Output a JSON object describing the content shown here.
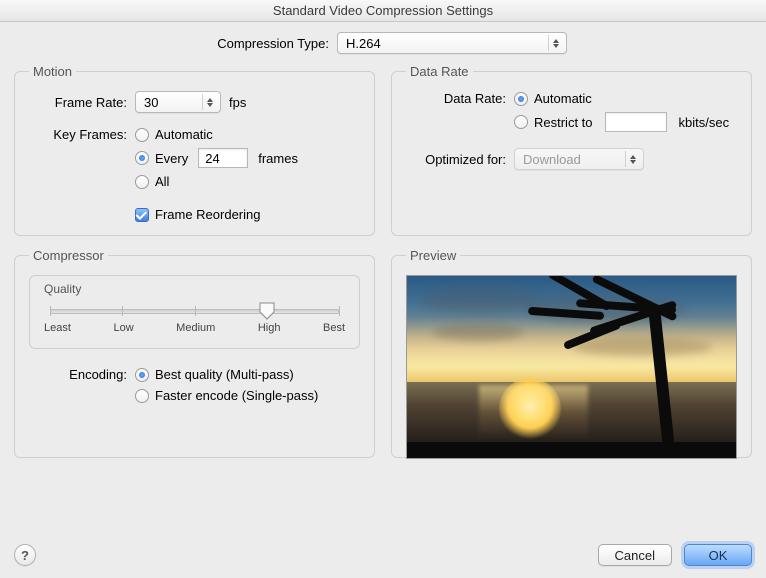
{
  "window_title": "Standard Video Compression Settings",
  "compression_type_label": "Compression Type:",
  "compression_type_value": "H.264",
  "motion": {
    "legend": "Motion",
    "frame_rate_label": "Frame Rate:",
    "frame_rate_value": "30",
    "frame_rate_unit": "fps",
    "key_frames_label": "Key Frames:",
    "kf_automatic": "Automatic",
    "kf_every": "Every",
    "kf_every_value": "24",
    "kf_every_unit": "frames",
    "kf_all": "All",
    "frame_reordering": "Frame Reordering"
  },
  "data_rate": {
    "legend": "Data Rate",
    "label": "Data Rate:",
    "automatic": "Automatic",
    "restrict_to": "Restrict to",
    "restrict_value": "",
    "restrict_unit": "kbits/sec",
    "optimized_for_label": "Optimized for:",
    "optimized_for_value": "Download"
  },
  "compressor": {
    "legend": "Compressor",
    "quality_legend": "Quality",
    "ticks": [
      "Least",
      "Low",
      "Medium",
      "High",
      "Best"
    ],
    "encoding_label": "Encoding:",
    "enc_best": "Best quality (Multi-pass)",
    "enc_fast": "Faster encode (Single-pass)"
  },
  "preview": {
    "legend": "Preview"
  },
  "buttons": {
    "help": "?",
    "cancel": "Cancel",
    "ok": "OK"
  }
}
